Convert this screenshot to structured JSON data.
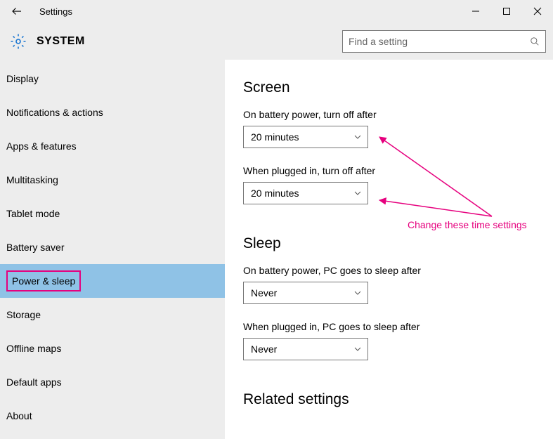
{
  "titlebar": {
    "title": "Settings"
  },
  "header": {
    "title": "SYSTEM",
    "search_placeholder": "Find a setting"
  },
  "sidebar": {
    "items": [
      {
        "label": "Display"
      },
      {
        "label": "Notifications & actions"
      },
      {
        "label": "Apps & features"
      },
      {
        "label": "Multitasking"
      },
      {
        "label": "Tablet mode"
      },
      {
        "label": "Battery saver"
      },
      {
        "label": "Power & sleep",
        "selected": true
      },
      {
        "label": "Storage"
      },
      {
        "label": "Offline maps"
      },
      {
        "label": "Default apps"
      },
      {
        "label": "About"
      }
    ]
  },
  "main": {
    "sections": {
      "screen": {
        "title": "Screen",
        "battery_label": "On battery power, turn off after",
        "battery_value": "20 minutes",
        "plugged_label": "When plugged in, turn off after",
        "plugged_value": "20 minutes"
      },
      "sleep": {
        "title": "Sleep",
        "battery_label": "On battery power, PC goes to sleep after",
        "battery_value": "Never",
        "plugged_label": "When plugged in, PC goes to sleep after",
        "plugged_value": "Never"
      },
      "related": {
        "title": "Related settings"
      }
    }
  },
  "annotation": {
    "text": "Change these time settings"
  }
}
